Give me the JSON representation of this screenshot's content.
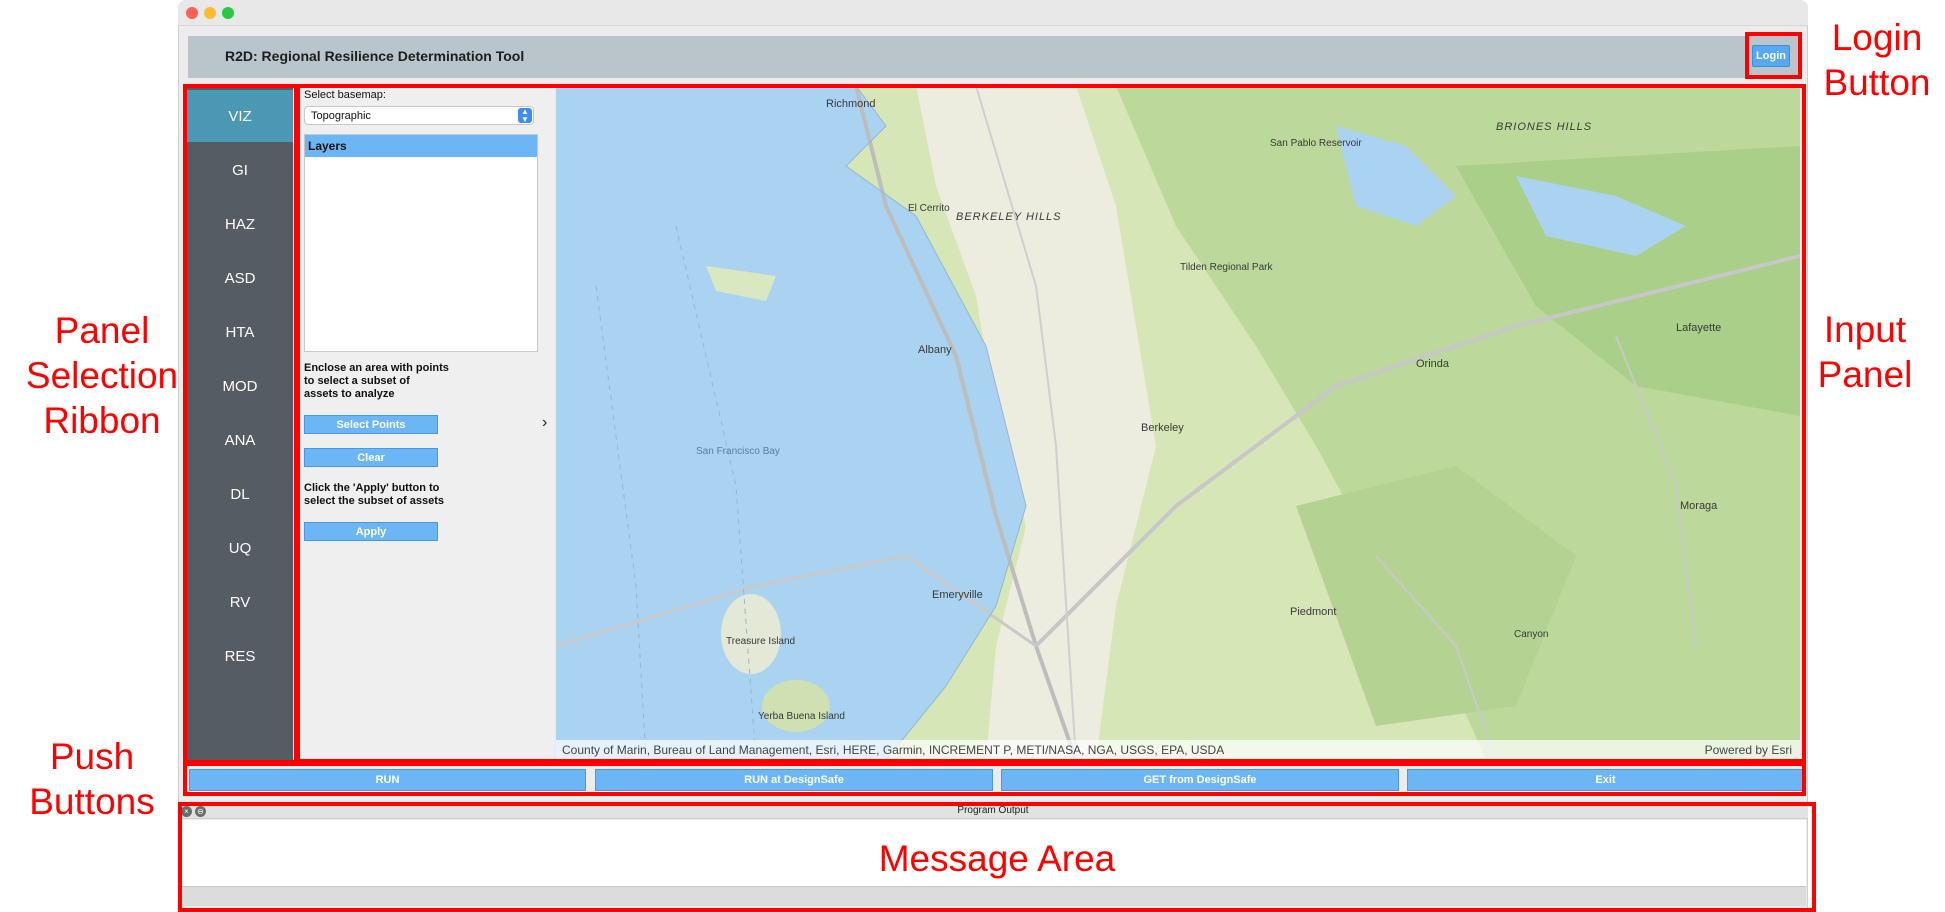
{
  "app": {
    "title": "R2D: Regional Resilience Determination Tool",
    "login_label": "Login"
  },
  "ribbon": {
    "items": [
      "VIZ",
      "GI",
      "HAZ",
      "ASD",
      "HTA",
      "MOD",
      "ANA",
      "DL",
      "UQ",
      "RV",
      "RES"
    ],
    "active": "VIZ"
  },
  "viz_panel": {
    "basemap_label": "Select basemap:",
    "basemap_value": "Topographic",
    "layers_header": "Layers",
    "enclose_text": [
      "Enclose an area with points",
      "to select a subset of",
      "assets to analyze"
    ],
    "select_points_label": "Select Points",
    "clear_label": "Clear",
    "apply_text": [
      "Click the 'Apply' button to",
      "select the subset of assets"
    ],
    "apply_label": "Apply"
  },
  "map": {
    "attribution": "County of Marin, Bureau of Land Management, Esri, HERE, Garmin, INCREMENT P, METI/NASA, NGA, USGS, EPA, USDA",
    "powered_by": "Powered by Esri",
    "labels": [
      "Richmond",
      "BERKELEY HILLS",
      "BRIONES HILLS",
      "Albany",
      "Berkeley",
      "Emeryville",
      "Orinda",
      "Lafayette",
      "Moraga",
      "Piedmont",
      "El Cerrito",
      "San Pablo Reservoir",
      "Tilden Regional Park",
      "San Francisco Bay",
      "Treasure Island",
      "Canyon",
      "Yerba Buena Island"
    ]
  },
  "push_buttons": {
    "run": "RUN",
    "run_designsafe": "RUN at DesignSafe",
    "get_designsafe": "GET from DesignSafe",
    "exit": "Exit"
  },
  "output": {
    "title": "Program Output"
  },
  "annotations": {
    "login_button": [
      "Login",
      "Button"
    ],
    "input_panel": [
      "Input",
      "Panel"
    ],
    "panel_selection_ribbon": [
      "Panel",
      "Selection",
      "Ribbon"
    ],
    "push_buttons": [
      "Push",
      "Buttons"
    ],
    "message_area": "Message Area"
  },
  "colors": {
    "annotation_red": "#ff0000",
    "ribbon_bg": "#565c63",
    "ribbon_active": "#4a98b3",
    "button_blue": "#6cb6f5",
    "water": "#aad3f2",
    "land": "#c9dfa6"
  }
}
